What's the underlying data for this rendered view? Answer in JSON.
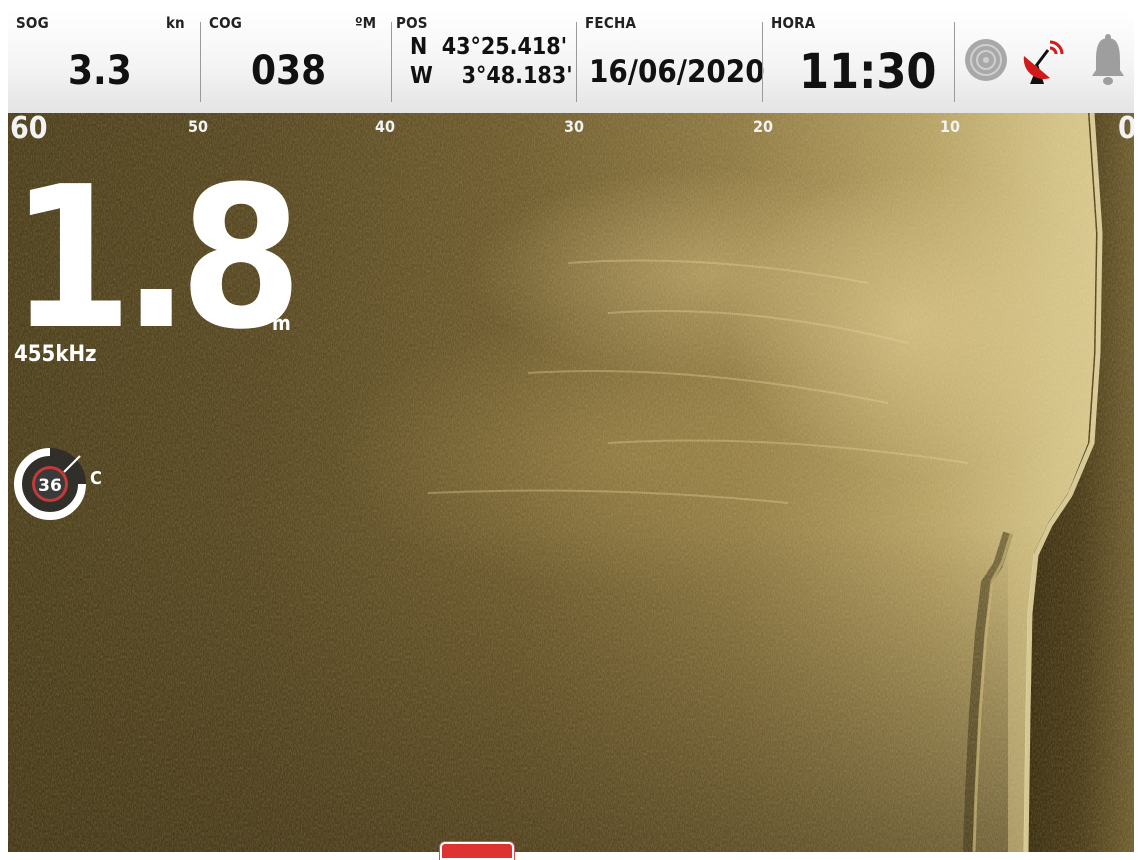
{
  "topbar": {
    "sog": {
      "label": "SOG",
      "unit": "kn",
      "value": "3.3"
    },
    "cog": {
      "label": "COG",
      "unit": "ºM",
      "value": "038"
    },
    "pos": {
      "label": "POS",
      "lat": "N  43°25.418'",
      "lon": "W    3°48.183'"
    },
    "fecha": {
      "label": "FECHA",
      "value": "16/06/2020"
    },
    "hora": {
      "label": "HORA",
      "value": "11:30"
    },
    "icons": [
      "sonar-icon",
      "satellite-dish-icon",
      "alarm-bell-icon"
    ]
  },
  "sonar": {
    "range_ticks": [
      "60",
      "50",
      "40",
      "30",
      "20",
      "10",
      "0"
    ],
    "depth": {
      "value": "1.8",
      "unit": "m"
    },
    "frequency": "455kHz",
    "temperature": {
      "value": "36",
      "unit": "C"
    }
  },
  "colors": {
    "sonar_dark": "#4c3f1b",
    "sonar_light": "#dccb92",
    "alert_red": "#d33",
    "dish_red": "#d21a1a"
  }
}
